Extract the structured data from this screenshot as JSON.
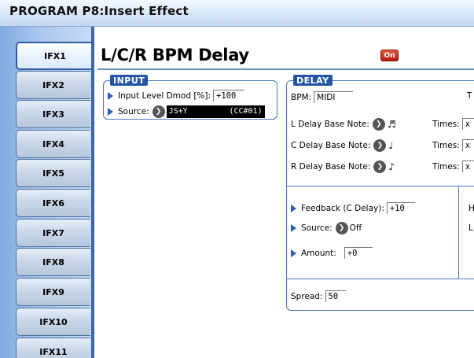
{
  "header": {
    "title": "PROGRAM P8:Insert Effect"
  },
  "tabs": [
    {
      "label": "IFX1",
      "active": true
    },
    {
      "label": "IFX2"
    },
    {
      "label": "IFX3"
    },
    {
      "label": "IFX4"
    },
    {
      "label": "IFX5"
    },
    {
      "label": "IFX6"
    },
    {
      "label": "IFX7"
    },
    {
      "label": "IFX8"
    },
    {
      "label": "IFX9"
    },
    {
      "label": "IFX10"
    },
    {
      "label": "IFX11"
    }
  ],
  "effect": {
    "name": "L/C/R BPM Delay",
    "on_label": "On"
  },
  "input": {
    "title": "INPUT",
    "level_label": "Input Level Dmod [%]:",
    "level_value": "+100",
    "source_label": "Source:",
    "source_value": "JS+Y",
    "source_cc": "(CC#01)"
  },
  "delay": {
    "title": "DELAY",
    "bpm_label": "BPM:",
    "bpm_value": "MIDI",
    "times_partial": "T",
    "l_label": "L Delay Base Note:",
    "c_label": "C Delay Base Note:",
    "r_label": "R Delay Base Note:",
    "l_note": "♬",
    "c_note": "♩",
    "r_note": "♪",
    "times_label": "Times:",
    "times_value": "x",
    "feedback_label": "Feedback (C Delay):",
    "feedback_value": "+10",
    "fb_source_label": "Source:",
    "fb_source_value": "Off",
    "amount_label": "Amount:",
    "amount_value": "+0",
    "spread_label": "Spread:",
    "spread_value": "50",
    "right_h": "H",
    "right_l": "L"
  },
  "colors": {
    "accent": "#2456a8",
    "on_button": "#d0351c",
    "tab_column": "#a9c6ee"
  }
}
